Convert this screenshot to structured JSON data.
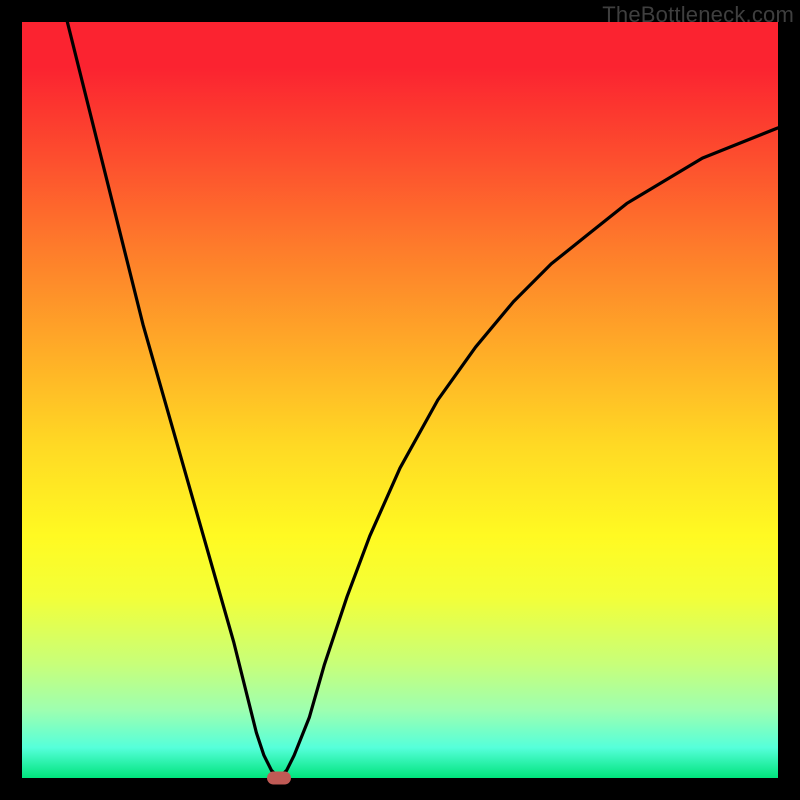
{
  "watermark": "TheBottleneck.com",
  "chart_data": {
    "type": "line",
    "title": "",
    "xlabel": "",
    "ylabel": "",
    "xlim": [
      0,
      100
    ],
    "ylim": [
      0,
      100
    ],
    "grid": false,
    "series": [
      {
        "name": "curve",
        "x": [
          6,
          8,
          10,
          12,
          14,
          16,
          18,
          20,
          22,
          24,
          26,
          28,
          30,
          31,
          32,
          33,
          34,
          35,
          36,
          38,
          40,
          43,
          46,
          50,
          55,
          60,
          65,
          70,
          75,
          80,
          85,
          90,
          95,
          100
        ],
        "y": [
          100,
          92,
          84,
          76,
          68,
          60,
          53,
          46,
          39,
          32,
          25,
          18,
          10,
          6,
          3,
          1,
          0,
          1,
          3,
          8,
          15,
          24,
          32,
          41,
          50,
          57,
          63,
          68,
          72,
          76,
          79,
          82,
          84,
          86
        ]
      }
    ],
    "marker": {
      "x": 34,
      "y": 0
    }
  },
  "colors": {
    "curve": "#000000",
    "marker": "#c05a55",
    "frame_bg_top": "#fb2330",
    "frame_bg_bottom": "#00e47c"
  }
}
